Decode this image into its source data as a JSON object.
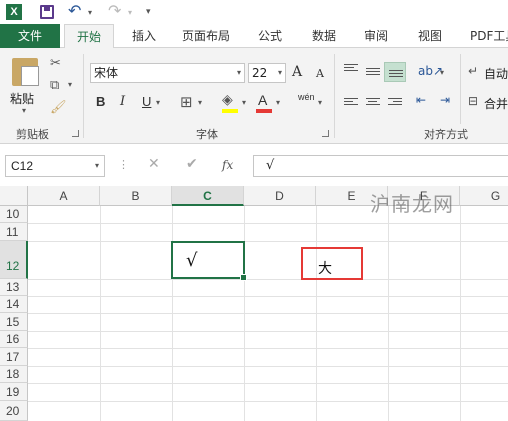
{
  "app": {
    "icon_text": "X"
  },
  "tabs": [
    {
      "label": "文件"
    },
    {
      "label": "开始"
    },
    {
      "label": "插入"
    },
    {
      "label": "页面布局"
    },
    {
      "label": "公式"
    },
    {
      "label": "数据"
    },
    {
      "label": "审阅"
    },
    {
      "label": "视图"
    },
    {
      "label": "PDF工具"
    }
  ],
  "ribbon": {
    "clipboard": {
      "paste_label": "粘贴",
      "group_label": "剪贴板"
    },
    "font": {
      "font_name": "宋体",
      "font_size": "22",
      "bold": "B",
      "italic": "I",
      "underline": "U",
      "grow": "A",
      "shrink": "A",
      "font_color_letter": "A",
      "phonetic": "wén",
      "group_label": "字体"
    },
    "alignment": {
      "wrap_label": "自动",
      "merge_label": "合并",
      "group_label": "对齐方式"
    }
  },
  "formula_bar": {
    "name_box": "C12",
    "cancel": "✕",
    "enter": "✔",
    "fx": "fx",
    "formula": "√"
  },
  "columns": [
    "A",
    "B",
    "C",
    "D",
    "E",
    "F",
    "G"
  ],
  "rows": [
    "10",
    "11",
    "12",
    "13",
    "14",
    "15",
    "16",
    "17",
    "18",
    "19",
    "20"
  ],
  "cells": {
    "C12": "√",
    "E12": "大"
  },
  "watermark": "沪南龙网",
  "colors": {
    "accent": "#217346",
    "highlight_box": "#e53935"
  }
}
